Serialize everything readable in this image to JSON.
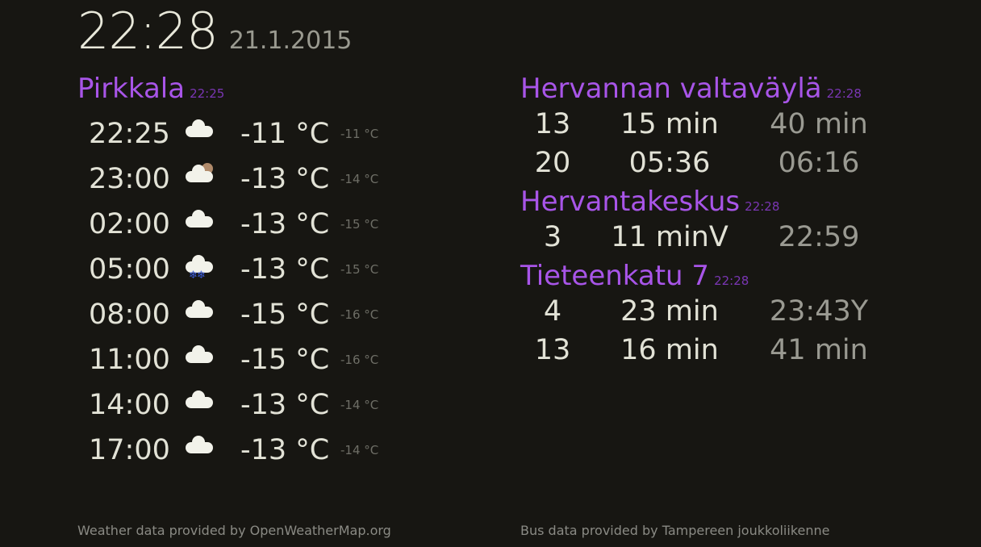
{
  "header": {
    "time": "22:28",
    "date": "21.1.2015"
  },
  "weather": {
    "location": "Pirkkala",
    "updated": "22:25",
    "rows": [
      {
        "time": "22:25",
        "icon": "cloud-dark-icon",
        "temp": "-11 °C",
        "min": "-11 °C"
      },
      {
        "time": "23:00",
        "icon": "cloud-moon-icon",
        "temp": "-13 °C",
        "min": "-14 °C"
      },
      {
        "time": "02:00",
        "icon": "cloud-dark-icon",
        "temp": "-13 °C",
        "min": "-15 °C"
      },
      {
        "time": "05:00",
        "icon": "snow-cloud-icon",
        "temp": "-13 °C",
        "min": "-15 °C"
      },
      {
        "time": "08:00",
        "icon": "cloud-icon",
        "temp": "-15 °C",
        "min": "-16 °C"
      },
      {
        "time": "11:00",
        "icon": "cloud-icon",
        "temp": "-15 °C",
        "min": "-16 °C"
      },
      {
        "time": "14:00",
        "icon": "cloud-dark-icon",
        "temp": "-13 °C",
        "min": "-14 °C"
      },
      {
        "time": "17:00",
        "icon": "cloud-dark-icon",
        "temp": "-13 °C",
        "min": "-14 °C"
      }
    ],
    "footer": "Weather data provided by OpenWeatherMap.org"
  },
  "bus": {
    "stops": [
      {
        "name": "Hervannan valtaväylä",
        "updated": "22:28",
        "departures": [
          {
            "line": "13",
            "next": "15 min",
            "after": "40 min"
          },
          {
            "line": "20",
            "next": "05:36",
            "after": "06:16"
          }
        ]
      },
      {
        "name": "Hervantakeskus",
        "updated": "22:28",
        "departures": [
          {
            "line": "3",
            "next": "11 minV",
            "after": "22:59"
          }
        ]
      },
      {
        "name": "Tieteenkatu 7",
        "updated": "22:28",
        "departures": [
          {
            "line": "4",
            "next": "23 min",
            "after": "23:43Y"
          },
          {
            "line": "13",
            "next": "16 min",
            "after": "41 min"
          }
        ]
      }
    ],
    "footer": "Bus data provided by Tampereen joukkoliikenne"
  },
  "colors": {
    "accent": "#a855e8",
    "background": "#171612",
    "text": "#e0e0d4"
  }
}
